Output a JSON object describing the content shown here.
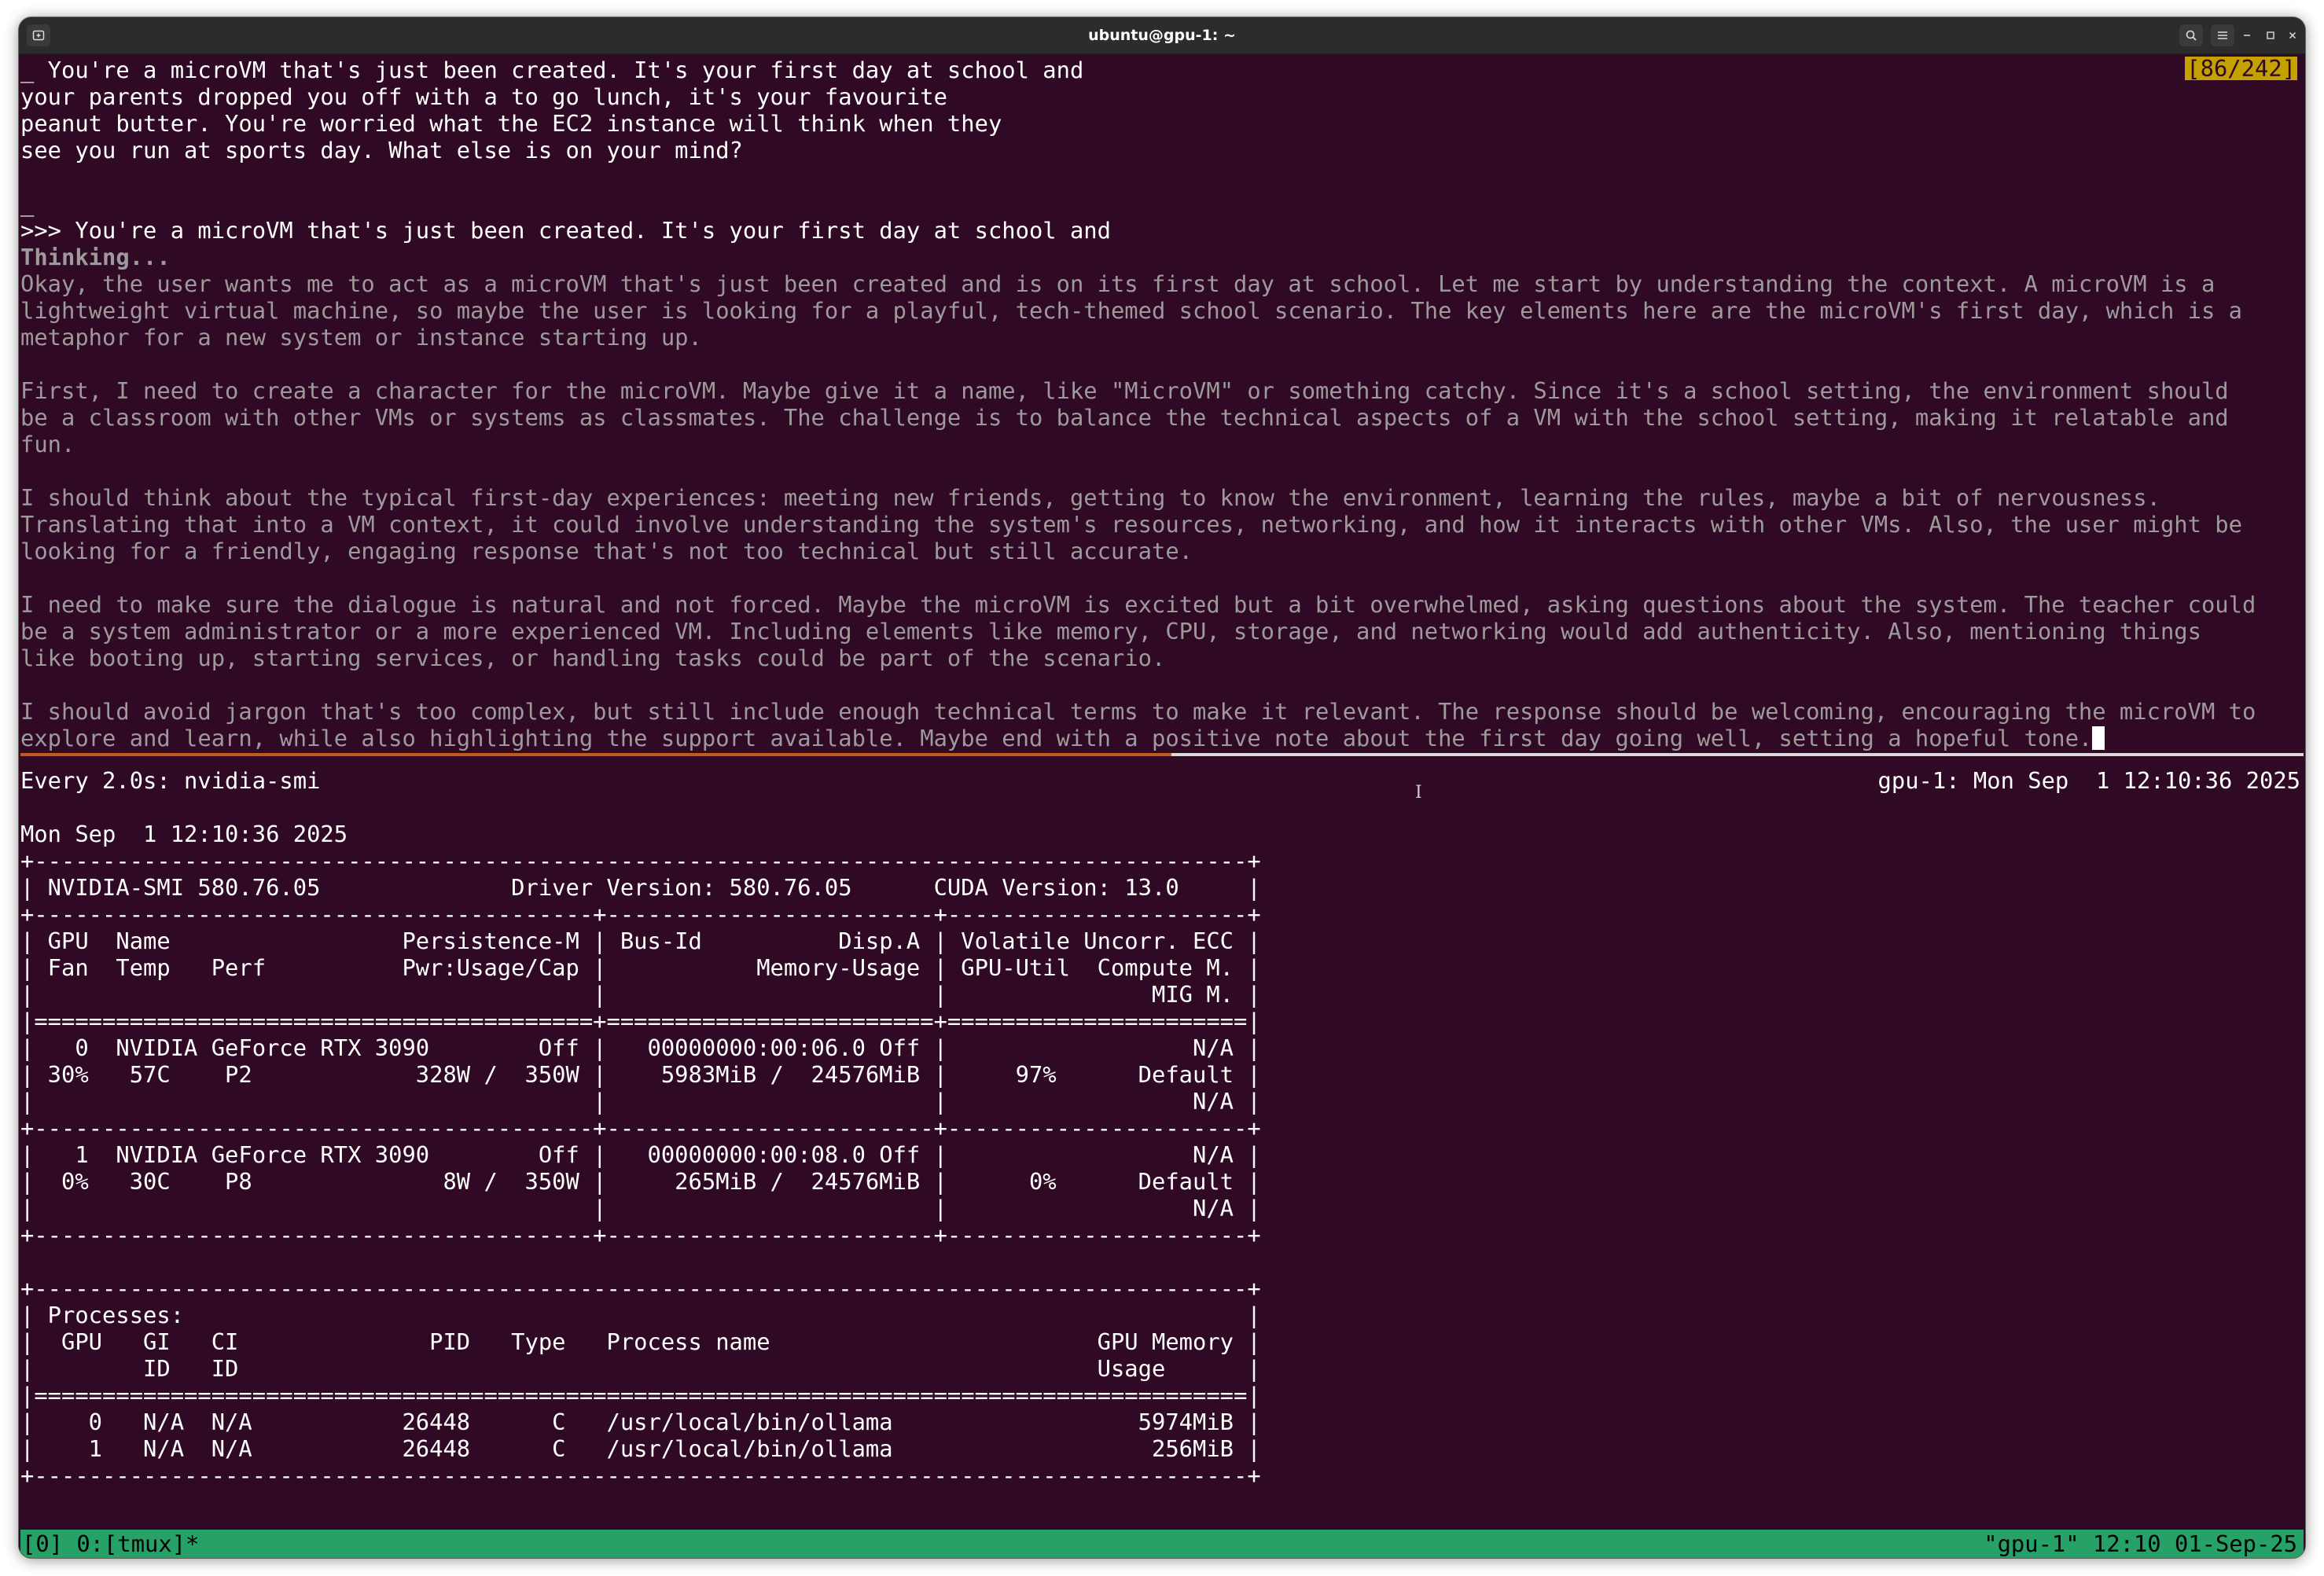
{
  "window": {
    "title": "ubuntu@gpu-1: ~"
  },
  "top_pane": {
    "position_indicator": "[86/242]",
    "lines": [
      {
        "text": "_ You're a microVM that's just been created. It's your first day at school and",
        "style": "normal"
      },
      {
        "text": "your parents dropped you off with a to go lunch, it's your favourite",
        "style": "normal"
      },
      {
        "text": "peanut butter. You're worried what the EC2 instance will think when they",
        "style": "normal"
      },
      {
        "text": "see you run at sports day. What else is on your mind?",
        "style": "normal"
      },
      {
        "text": "",
        "style": "normal"
      },
      {
        "text": "_",
        "style": "normal"
      },
      {
        "text": ">>> You're a microVM that's just been created. It's your first day at school and",
        "style": "normal"
      },
      {
        "text": "Thinking...",
        "style": "gray-bold"
      },
      {
        "text": "Okay, the user wants me to act as a microVM that's just been created and is on its first day at school. Let me start by understanding the context. A microVM is a",
        "style": "gray"
      },
      {
        "text": "lightweight virtual machine, so maybe the user is looking for a playful, tech-themed school scenario. The key elements here are the microVM's first day, which is a",
        "style": "gray"
      },
      {
        "text": "metaphor for a new system or instance starting up.",
        "style": "gray"
      },
      {
        "text": "",
        "style": "gray"
      },
      {
        "text": "First, I need to create a character for the microVM. Maybe give it a name, like \"MicroVM\" or something catchy. Since it's a school setting, the environment should",
        "style": "gray"
      },
      {
        "text": "be a classroom with other VMs or systems as classmates. The challenge is to balance the technical aspects of a VM with the school setting, making it relatable and",
        "style": "gray"
      },
      {
        "text": "fun.",
        "style": "gray"
      },
      {
        "text": "",
        "style": "gray"
      },
      {
        "text": "I should think about the typical first-day experiences: meeting new friends, getting to know the environment, learning the rules, maybe a bit of nervousness.",
        "style": "gray"
      },
      {
        "text": "Translating that into a VM context, it could involve understanding the system's resources, networking, and how it interacts with other VMs. Also, the user might be",
        "style": "gray"
      },
      {
        "text": "looking for a friendly, engaging response that's not too technical but still accurate.",
        "style": "gray"
      },
      {
        "text": "",
        "style": "gray"
      },
      {
        "text": "I need to make sure the dialogue is natural and not forced. Maybe the microVM is excited but a bit overwhelmed, asking questions about the system. The teacher could",
        "style": "gray"
      },
      {
        "text": "be a system administrator or a more experienced VM. Including elements like memory, CPU, storage, and networking would add authenticity. Also, mentioning things",
        "style": "gray"
      },
      {
        "text": "like booting up, starting services, or handling tasks could be part of the scenario.",
        "style": "gray"
      },
      {
        "text": "",
        "style": "gray"
      },
      {
        "text": "I should avoid jargon that's too complex, but still include enough technical terms to make it relevant. The response should be welcoming, encouraging the microVM to",
        "style": "gray"
      },
      {
        "text": "explore and learn, while also highlighting the support available. Maybe end with a positive note about the first day going well, setting a hopeful tone.",
        "style": "gray-cursor"
      }
    ]
  },
  "bottom_pane": {
    "watch_header_left": "Every 2.0s: nvidia-smi",
    "watch_header_right": "gpu-1: Mon Sep  1 12:10:36 2025",
    "lines": [
      "Mon Sep  1 12:10:36 2025",
      "+-----------------------------------------------------------------------------------------+",
      "| NVIDIA-SMI 580.76.05              Driver Version: 580.76.05      CUDA Version: 13.0     |",
      "+-----------------------------------------+------------------------+----------------------+",
      "| GPU  Name                 Persistence-M | Bus-Id          Disp.A | Volatile Uncorr. ECC |",
      "| Fan  Temp   Perf          Pwr:Usage/Cap |           Memory-Usage | GPU-Util  Compute M. |",
      "|                                         |                        |               MIG M. |",
      "|=========================================+========================+======================|",
      "|   0  NVIDIA GeForce RTX 3090        Off |   00000000:00:06.0 Off |                  N/A |",
      "| 30%   57C    P2            328W /  350W |    5983MiB /  24576MiB |     97%      Default |",
      "|                                         |                        |                  N/A |",
      "+-----------------------------------------+------------------------+----------------------+",
      "|   1  NVIDIA GeForce RTX 3090        Off |   00000000:00:08.0 Off |                  N/A |",
      "|  0%   30C    P8              8W /  350W |     265MiB /  24576MiB |      0%      Default |",
      "|                                         |                        |                  N/A |",
      "+-----------------------------------------+------------------------+----------------------+",
      "",
      "+-----------------------------------------------------------------------------------------+",
      "| Processes:                                                                              |",
      "|  GPU   GI   CI              PID   Type   Process name                        GPU Memory |",
      "|        ID   ID                                                               Usage      |",
      "|=========================================================================================|",
      "|    0   N/A  N/A           26448      C   /usr/local/bin/ollama                  5974MiB |",
      "|    1   N/A  N/A           26448      C   /usr/local/bin/ollama                   256MiB |",
      "+-----------------------------------------------------------------------------------------+"
    ]
  },
  "statusbar": {
    "left": "[0] 0:[tmux]*",
    "right": "\"gpu-1\" 12:10 01-Sep-25"
  },
  "colors": {
    "terminal_bg": "#300a24",
    "tmux_status": "#26a269",
    "active_pane_border": "#c45a1a",
    "indicator_bg": "#c4a000"
  }
}
